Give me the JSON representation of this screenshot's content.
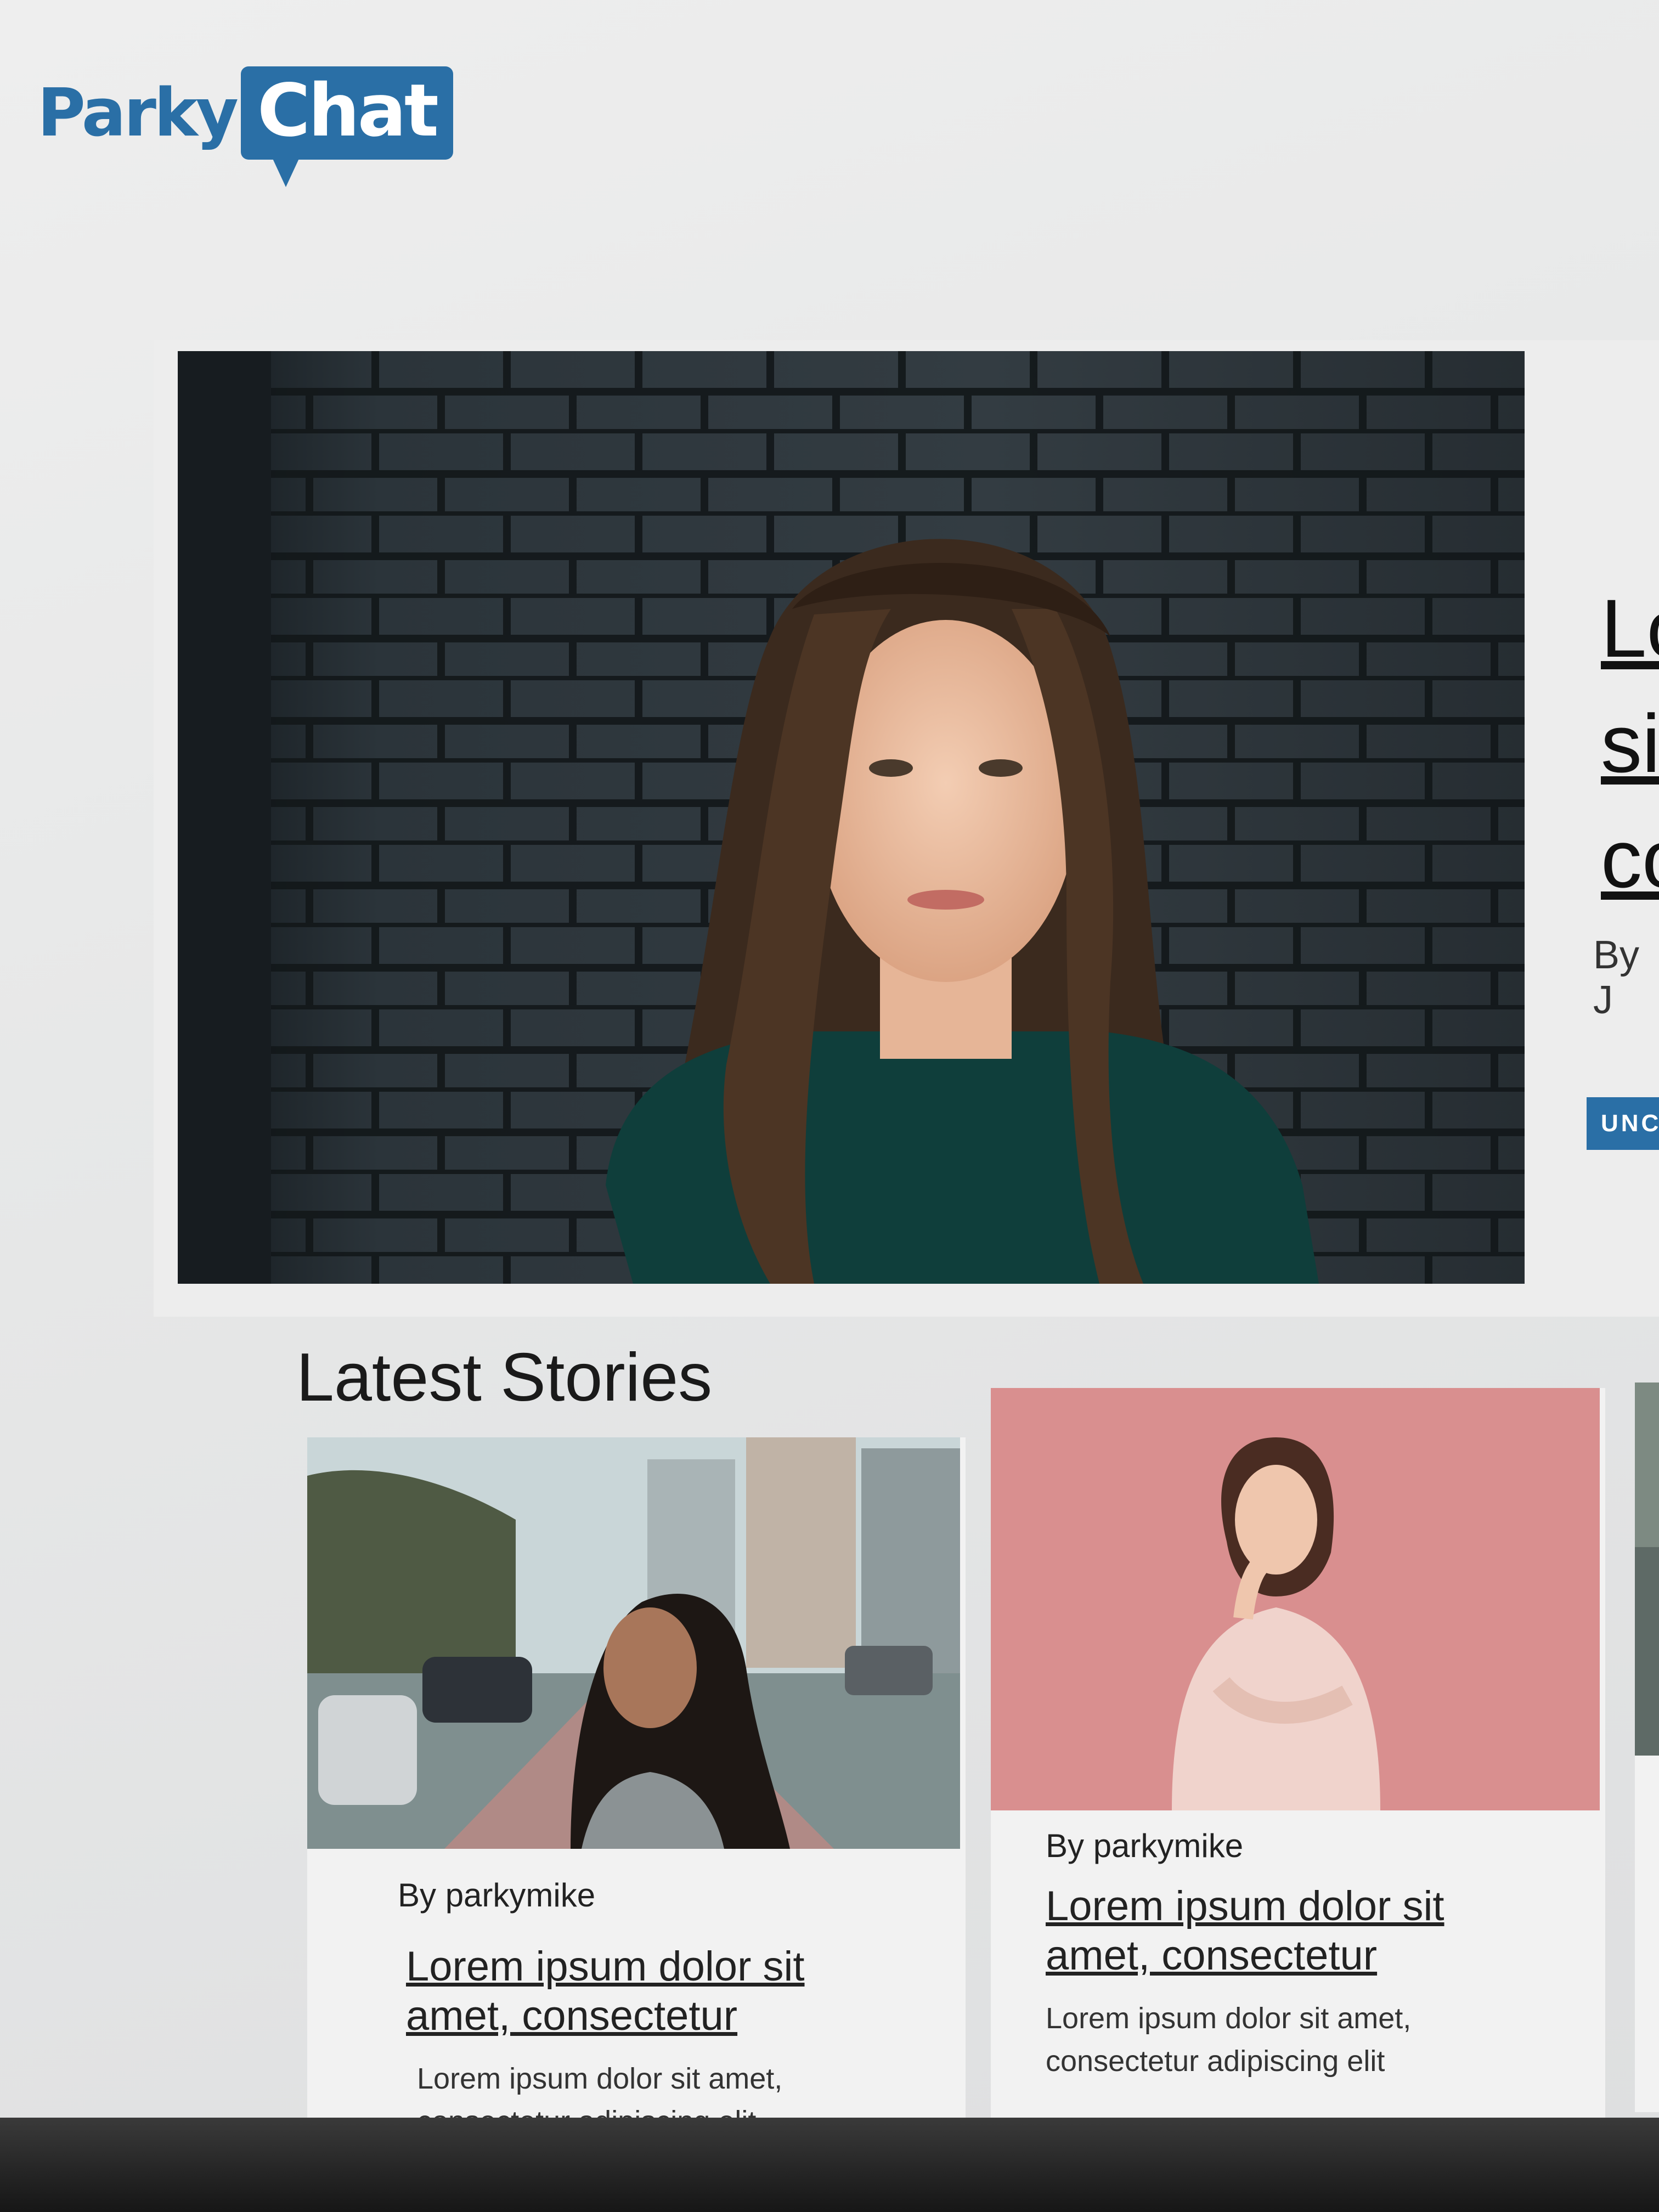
{
  "brand": {
    "logo_word1": "Parky",
    "logo_word2": "Chat",
    "brand_color": "#2a6fa6"
  },
  "featured": {
    "title_partial": "Lo\nsi\nco",
    "byline_partial": "By J",
    "category_partial": "UNC"
  },
  "latest": {
    "heading": "Latest Stories",
    "stories": [
      {
        "byline": "By parkymike",
        "title": "Lorem ipsum dolor sit amet, consectetur",
        "excerpt": "Lorem ipsum dolor sit amet, consectetur adipiscing elit"
      },
      {
        "byline": "By parkymike",
        "title": "Lorem ipsum dolor sit amet, consectetur",
        "excerpt": "Lorem ipsum dolor sit amet, consectetur adipiscing elit"
      }
    ]
  }
}
